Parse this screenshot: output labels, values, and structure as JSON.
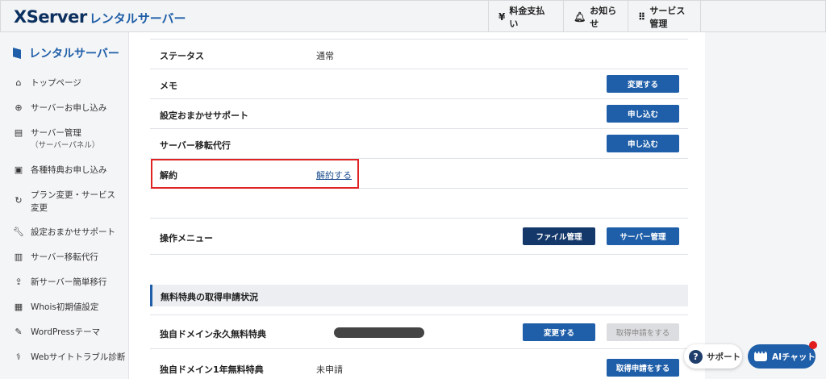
{
  "header": {
    "logo_main": "XServer",
    "logo_sub": "レンタルサーバー",
    "nav": [
      {
        "label": "料金支払い",
        "icon": "yen-icon"
      },
      {
        "label": "お知らせ",
        "icon": "bell-icon"
      },
      {
        "label": "サービス管理",
        "icon": "grid-icon"
      }
    ]
  },
  "sidebar": {
    "title": "レンタルサーバー",
    "items": [
      {
        "label": "トップページ",
        "icon": "home-icon"
      },
      {
        "label": "サーバーお申し込み",
        "icon": "plus-circle-icon"
      },
      {
        "label": "サーバー管理",
        "sub": "（サーバーパネル）",
        "icon": "server-icon"
      },
      {
        "label": "各種特典お申し込み",
        "icon": "gift-icon"
      },
      {
        "label": "プラン変更・サービス変更",
        "icon": "refresh-icon"
      },
      {
        "label": "設定おまかせサポート",
        "icon": "wrench-icon"
      },
      {
        "label": "サーバー移転代行",
        "icon": "server-transfer-icon"
      },
      {
        "label": "新サーバー簡単移行",
        "icon": "upload-icon"
      },
      {
        "label": "Whois初期値設定",
        "icon": "document-icon"
      },
      {
        "label": "WordPressテーマ",
        "icon": "edit-icon"
      },
      {
        "label": "Webサイトトラブル診断",
        "icon": "stethoscope-icon"
      }
    ]
  },
  "main": {
    "rows": [
      {
        "label": "ステータス",
        "value": "通常"
      },
      {
        "label": "メモ",
        "button": "変更する"
      },
      {
        "label": "設定おまかせサポート",
        "button": "申し込む"
      },
      {
        "label": "サーバー移転代行",
        "button": "申し込む"
      },
      {
        "label": "解約",
        "link": "解約する"
      }
    ],
    "operation": {
      "label": "操作メニュー",
      "file_button": "ファイル管理",
      "server_button": "サーバー管理"
    },
    "section_title": "無料特典の取得申請状況",
    "benefits": [
      {
        "label": "独自ドメイン永久無料特典",
        "change_button": "変更する",
        "apply_button": "取得申請をする"
      },
      {
        "label": "独自ドメイン1年無料特典",
        "status": "未申請",
        "apply_button": "取得申請をする"
      }
    ]
  },
  "floating": {
    "support_label": "サポート",
    "ai_label": "AIチャット"
  }
}
